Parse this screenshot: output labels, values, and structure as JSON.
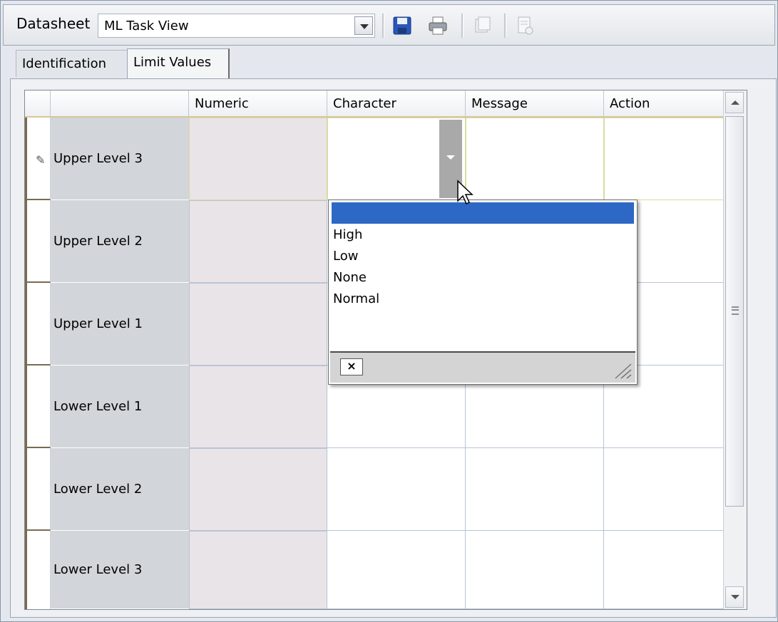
{
  "toolbar": {
    "datasheet_label": "Datasheet",
    "datasheet_value": "ML Task View",
    "icons": [
      "chevron-down-icon",
      "save-icon",
      "print-icon",
      "copy-icon",
      "properties-icon"
    ]
  },
  "tabs": [
    {
      "label": "Identification"
    },
    {
      "label": "Limit Values"
    }
  ],
  "grid": {
    "columns": [
      "Numeric",
      "Character",
      "Message",
      "Action"
    ],
    "rows": [
      {
        "label": "Upper Level 3"
      },
      {
        "label": "Upper Level 2"
      },
      {
        "label": "Upper Level 1"
      },
      {
        "label": "Lower Level 1"
      },
      {
        "label": "Lower Level 2"
      },
      {
        "label": "Lower Level 3"
      }
    ]
  },
  "dropdown": {
    "selected_index": 0,
    "options": [
      "",
      "High",
      "Low",
      "None",
      "Normal"
    ],
    "close_symbol": "×"
  },
  "colors": {
    "selection": "#2d68c4",
    "label_cell_bg": "#d2d5d9",
    "numeric_cell_bg": "#e9e4e7"
  }
}
